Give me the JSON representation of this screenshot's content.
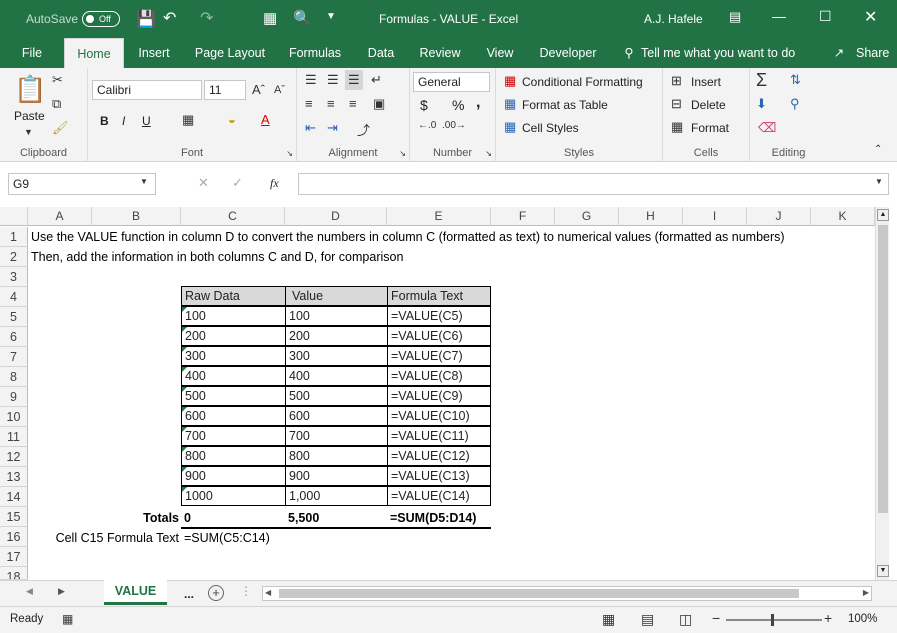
{
  "titlebar": {
    "autosave": "AutoSave",
    "toggle": "Off",
    "title": "Formulas - VALUE  -  Excel",
    "user": "A.J. Hafele"
  },
  "tabs": [
    "File",
    "Home",
    "Insert",
    "Page Layout",
    "Formulas",
    "Data",
    "Review",
    "View",
    "Developer"
  ],
  "tell_me": "Tell me what you want to do",
  "share": "Share",
  "ribbon": {
    "clipboard": {
      "paste": "Paste",
      "label": "Clipboard"
    },
    "font": {
      "name": "Calibri",
      "size": "11",
      "label": "Font",
      "bold": "B",
      "italic": "I",
      "underline": "U"
    },
    "alignment": {
      "label": "Alignment"
    },
    "number": {
      "format": "General",
      "label": "Number",
      "currency": "$",
      "percent": "%",
      "comma": ","
    },
    "styles": {
      "conditional": "Conditional Formatting",
      "table": "Format as Table",
      "cell": "Cell Styles",
      "label": "Styles"
    },
    "cells": {
      "insert": "Insert",
      "delete": "Delete",
      "format": "Format",
      "label": "Cells"
    },
    "editing": {
      "label": "Editing"
    }
  },
  "formula_bar": {
    "name_box": "G9",
    "fx": "fx",
    "content": ""
  },
  "columns": [
    "A",
    "B",
    "C",
    "D",
    "E",
    "F",
    "G",
    "H",
    "I",
    "J",
    "K"
  ],
  "rows": [
    "1",
    "2",
    "3",
    "4",
    "5",
    "6",
    "7",
    "8",
    "9",
    "10",
    "11",
    "12",
    "13",
    "14",
    "15",
    "16",
    "17",
    "18"
  ],
  "sheet": {
    "r1": "Use the VALUE function in column D to convert the numbers in column C (formatted as text) to numerical values (formatted as numbers)",
    "r2": "Then, add the information in both columns C and D, for comparison",
    "headers": [
      "Raw Data",
      "Value",
      "Formula Text"
    ],
    "raw": [
      "100",
      "200",
      "300",
      "400",
      "500",
      "600",
      "700",
      "800",
      "900",
      "1000"
    ],
    "value": [
      "100",
      "200",
      "300",
      "400",
      "500",
      "600",
      "700",
      "800",
      "900",
      "1,000"
    ],
    "formula": [
      "=VALUE(C5)",
      "=VALUE(C6)",
      "=VALUE(C7)",
      "=VALUE(C8)",
      "=VALUE(C9)",
      "=VALUE(C10)",
      "=VALUE(C11)",
      "=VALUE(C12)",
      "=VALUE(C13)",
      "=VALUE(C14)"
    ],
    "totals_label": "Totals",
    "total_c": "0",
    "total_d": "5,500",
    "total_formula": "=SUM(D5:D14)",
    "r16_label": "Cell C15 Formula Text",
    "r16_value": "=SUM(C5:C14)"
  },
  "sheet_tabs": {
    "active": "VALUE",
    "more": "..."
  },
  "status": {
    "ready": "Ready",
    "zoom": "100%"
  }
}
